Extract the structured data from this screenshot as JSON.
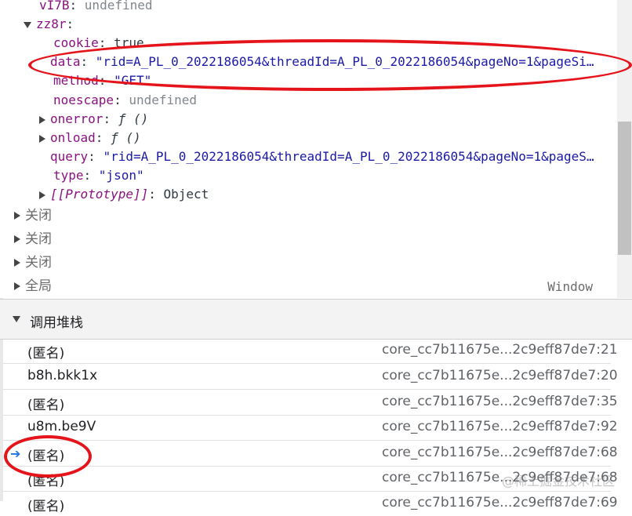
{
  "scope": {
    "lines": [
      {
        "key": "vI7B",
        "sep": ": ",
        "value": "undefined",
        "vclass": "undef"
      },
      {
        "key": "zz8r",
        "sep": ":",
        "value": "",
        "vclass": "plain"
      },
      {
        "key": "cookie",
        "sep": ": ",
        "value": "true",
        "vclass": "plain"
      },
      {
        "key": "data",
        "sep": ": ",
        "value": "\"rid=A_PL_0_2022186054&threadId=A_PL_0_2022186054&pageNo=1&pageSi…",
        "vclass": "str"
      },
      {
        "key": "method",
        "sep": ": ",
        "value": "\"GET\"",
        "vclass": "str"
      },
      {
        "key": "noescape",
        "sep": ": ",
        "value": "undefined",
        "vclass": "undef"
      },
      {
        "key": "onerror",
        "sep": ": ",
        "value": "ƒ ()",
        "vclass": "plain"
      },
      {
        "key": "onload",
        "sep": ": ",
        "value": "ƒ ()",
        "vclass": "plain"
      },
      {
        "key": "query",
        "sep": ": ",
        "value": "\"rid=A_PL_0_2022186054&threadId=A_PL_0_2022186054&pageNo=1&pageS…",
        "vclass": "str"
      },
      {
        "key": "type",
        "sep": ": ",
        "value": "\"json\"",
        "vclass": "str"
      },
      {
        "key": "[[Prototype]]",
        "sep": ": ",
        "value": "Object",
        "vclass": "plain"
      }
    ],
    "closures": [
      "关闭",
      "关闭",
      "关闭"
    ],
    "global_label": "全局",
    "global_value": "Window"
  },
  "callstack": {
    "title": "调用堆栈",
    "frames": [
      {
        "fn": "(匿名)",
        "loc": "core_cc7b11675e...2c9eff87de7:21"
      },
      {
        "fn": "b8h.bkk1x",
        "loc": "core_cc7b11675e...2c9eff87de7:20"
      },
      {
        "fn": "(匿名)",
        "loc": "core_cc7b11675e...2c9eff87de7:35"
      },
      {
        "fn": "u8m.be9V",
        "loc": "core_cc7b11675e...2c9eff87de7:92"
      },
      {
        "fn": "(匿名)",
        "loc": "core_cc7b11675e...2c9eff87de7:68"
      },
      {
        "fn": "(匿名)",
        "loc": "core_cc7b11675e...2c9eff87de7:68"
      },
      {
        "fn": "(匿名)",
        "loc": "core_cc7b11675e...2c9eff87de7:69"
      }
    ]
  },
  "watermark": "@稀土掘金技术社区",
  "colors": {
    "annotation": "#e5141b",
    "accent": "#1a73e8"
  }
}
